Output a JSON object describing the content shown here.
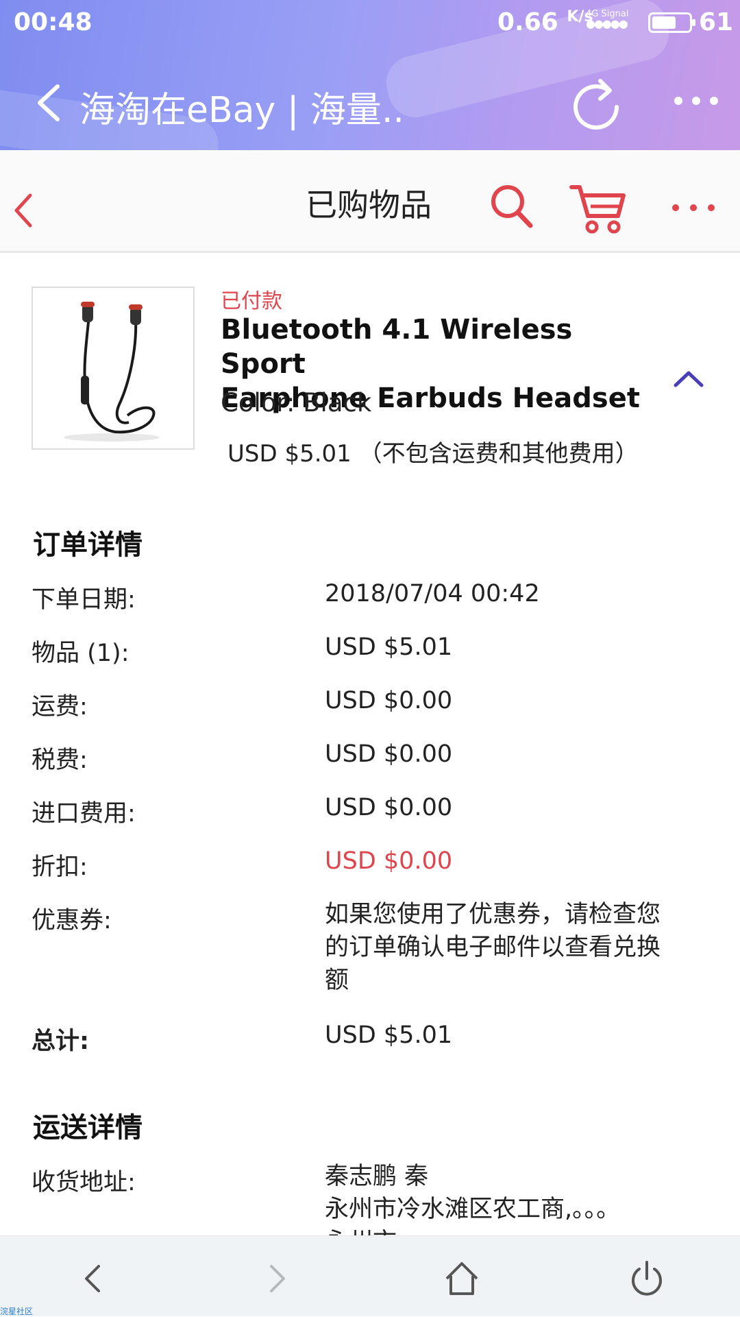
{
  "status_bar": {
    "time": "00:48",
    "speed": "0.66",
    "speed_unit": "K/s",
    "network": "4G",
    "signal_label": "Signal",
    "battery": "61"
  },
  "browser": {
    "title": "海淘在eBay | 海量..",
    "back_icon": "chevron-left-icon",
    "refresh_icon": "refresh-icon",
    "more_icon": "more-horizontal-icon"
  },
  "header": {
    "title": "已购物品",
    "accent_color": "#e0454d"
  },
  "item": {
    "status": "已付款",
    "title_line1": "Bluetooth 4.1 Wireless Sport",
    "title_line2": "Earphone Earbuds Headset",
    "color": "Color: Black",
    "price": "USD $5.01 （不包含运费和其他费用）"
  },
  "order": {
    "heading": "订单详情",
    "rows": [
      {
        "label": "下单日期:",
        "value": "2018/07/04 00:42"
      },
      {
        "label": "物品 (1):",
        "value": "USD $5.01"
      },
      {
        "label": "运费:",
        "value": "USD $0.00"
      },
      {
        "label": "税费:",
        "value": "USD $0.00"
      },
      {
        "label": "进口费用:",
        "value": "USD $0.00"
      },
      {
        "label": "折扣:",
        "value": "USD $0.00"
      },
      {
        "label": "优惠券:",
        "value": "如果您使用了优惠券，请检查您的订单确认电子邮件以查看兑换额"
      },
      {
        "label": "总计:",
        "value": "USD $5.01"
      }
    ]
  },
  "shipping": {
    "heading": "运送详情",
    "address_label": "收货地址:",
    "address_line1": "秦志鹏 秦",
    "address_line2": "永州市冷水滩区农工商,。。。",
    "address_line3": "永州市"
  },
  "bottom_nav": {
    "back_icon": "chevron-left-icon",
    "forward_icon": "chevron-right-icon",
    "home_icon": "home-icon",
    "power_icon": "power-icon"
  },
  "watermark": "浣星社区"
}
